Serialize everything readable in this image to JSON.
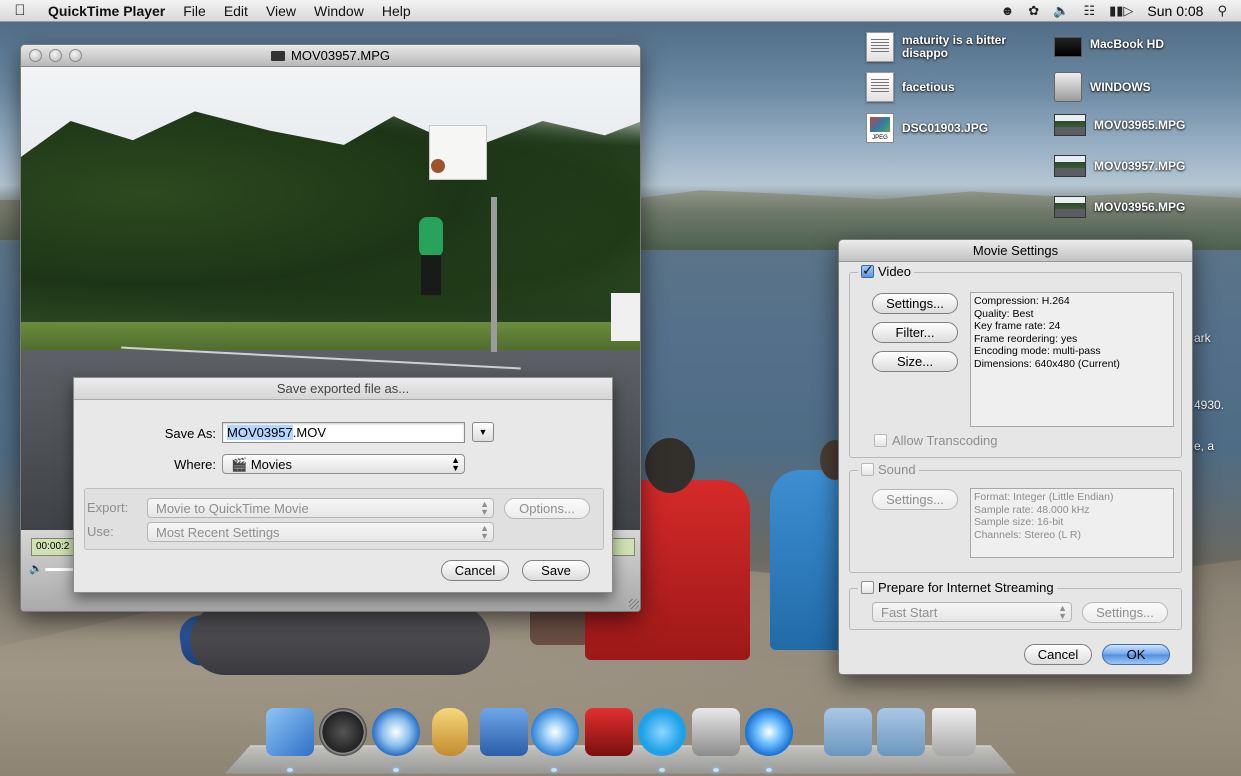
{
  "menubar": {
    "app_name": "QuickTime Player",
    "items": [
      "File",
      "Edit",
      "View",
      "Window",
      "Help"
    ],
    "clock": "Sun 0:08"
  },
  "desktop": {
    "icons": [
      {
        "label": "maturity is a bitter disappo",
        "icon": "text-document-icon"
      },
      {
        "label": "facetious",
        "icon": "text-document-icon"
      },
      {
        "label": "DSC01903.JPG",
        "icon": "jpeg-file-icon"
      },
      {
        "label": "MacBook HD",
        "icon": "hard-drive-icon"
      },
      {
        "label": "WINDOWS",
        "icon": "hard-drive-icon"
      },
      {
        "label": "MOV03965.MPG",
        "icon": "movie-file-icon"
      },
      {
        "label": "MOV03957.MPG",
        "icon": "movie-file-icon"
      },
      {
        "label": "MOV03956.MPG",
        "icon": "movie-file-icon"
      }
    ],
    "background_fragments": [
      "ark",
      "4930.",
      "e, a"
    ]
  },
  "player_window": {
    "title": "MOV03957.MPG",
    "timecode": "00:00:2"
  },
  "save_sheet": {
    "title": "Save exported file as...",
    "save_as_label": "Save As:",
    "filename_selected": "MOV03957",
    "filename_ext": ".MOV",
    "where_label": "Where:",
    "where_value": "Movies",
    "export_label": "Export:",
    "export_value": "Movie to QuickTime Movie",
    "options_button": "Options...",
    "use_label": "Use:",
    "use_value": "Most Recent Settings",
    "cancel_button": "Cancel",
    "save_button": "Save"
  },
  "movie_settings": {
    "title": "Movie Settings",
    "video": {
      "label": "Video",
      "checked": true,
      "settings_button": "Settings...",
      "filter_button": "Filter...",
      "size_button": "Size...",
      "info": [
        "Compression: H.264",
        "Quality: Best",
        "Key frame rate: 24",
        "Frame reordering: yes",
        "Encoding mode: multi-pass",
        "Dimensions: 640x480 (Current)"
      ],
      "allow_transcoding": "Allow Transcoding"
    },
    "sound": {
      "label": "Sound",
      "checked": false,
      "settings_button": "Settings...",
      "info": [
        "Format: Integer (Little Endian)",
        "Sample rate: 48.000 kHz",
        "Sample size: 16-bit",
        "Channels: Stereo (L R)"
      ]
    },
    "streaming": {
      "label": "Prepare for Internet Streaming",
      "checked": false,
      "mode": "Fast Start",
      "settings_button": "Settings..."
    },
    "cancel_button": "Cancel",
    "ok_button": "OK"
  },
  "dock": {
    "items": [
      "Finder",
      "Dashboard",
      "Safari",
      "iCal",
      "Preview",
      "iTunes",
      "Front Row",
      "Skype",
      "Boot Camp Assistant",
      "QuickTime Player",
      "Documents",
      "Downloads",
      "Trash"
    ]
  },
  "colors": {
    "accent_blue": "#5d95de",
    "selection": "#b4d5fe",
    "timecode_lcd": "#d0e2b4"
  }
}
